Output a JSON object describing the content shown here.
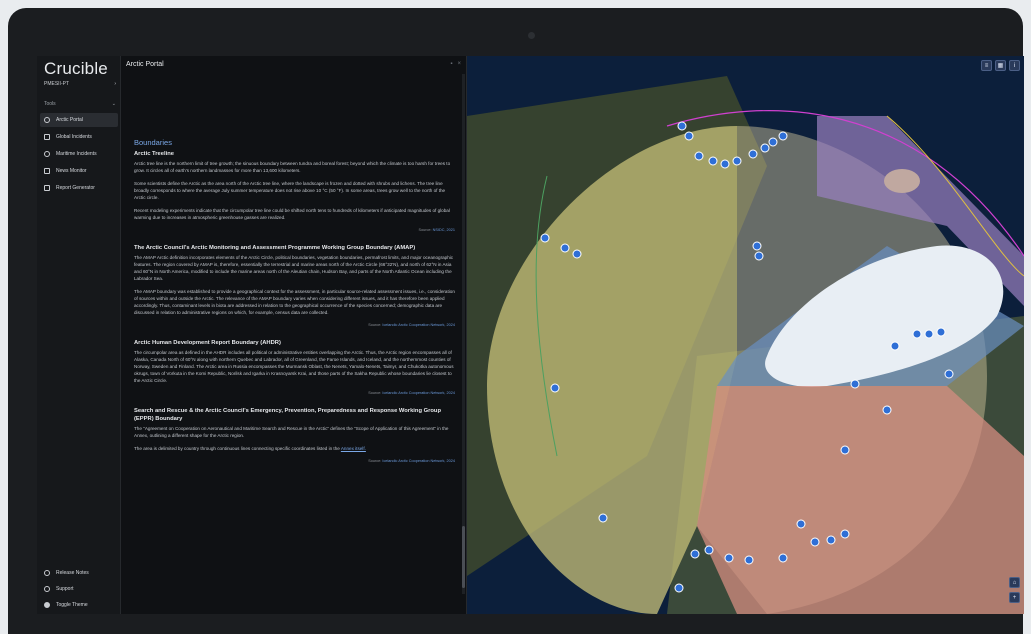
{
  "app": {
    "name": "Crucible"
  },
  "sidebar": {
    "project": "PMESII-PT",
    "section": "Tools",
    "items": [
      {
        "label": "Arctic Portal",
        "icon": "globe-icon",
        "active": true
      },
      {
        "label": "Global Incidents",
        "icon": "alert-icon",
        "active": false
      },
      {
        "label": "Maritime Incidents",
        "icon": "anchor-icon",
        "active": false
      },
      {
        "label": "News Monitor",
        "icon": "news-icon",
        "active": false
      },
      {
        "label": "Report Generator",
        "icon": "document-icon",
        "active": false
      }
    ],
    "footer": [
      {
        "label": "Release Notes",
        "icon": "info-icon"
      },
      {
        "label": "Support",
        "icon": "support-icon"
      },
      {
        "label": "Toggle Theme",
        "icon": "theme-icon"
      }
    ]
  },
  "panel": {
    "title": "Arctic Portal",
    "heading": "Boundaries",
    "sections": [
      {
        "title": "Arctic Treeline",
        "paragraphs": [
          "Arctic tree line is the northern limit of tree growth; the sinuous boundary between tundra and boreal forest; beyond which the climate is too harsh for trees to grow. It circles all of earth's northern landmasses for more than 13,600 kilometers.",
          "Some scientists define the Arctic as the area north of the Arctic tree line, where the landscape is frozen and dotted with shrubs and lichens. The tree line broadly corresponds to where the average July summer temperature does not rise above 10 °C (50 °F). In some areas, trees grow well to the north of the Arctic circle.",
          "Recent modeling experiments indicate that the circumpolar tree line could be shifted north tens to hundreds of kilometers if anticipated magnitudes of global warming due to increases in atmospheric greenhouse gasses are realized."
        ],
        "source_prefix": "Source:",
        "source": "NSIDC, 2021"
      },
      {
        "title": "The Arctic Council's Arctic Monitoring and Assessment Programme Working Group Boundary (AMAP)",
        "paragraphs": [
          "The AMAP Arctic definition incorporates elements of the Arctic Circle, political boundaries, vegetation boundaries, permafrost limits, and major oceanographic features. The region covered by AMAP is, therefore, essentially the terrestrial and marine areas north of the Arctic Circle (66°32'N), and north of 62°N in Asia and 60°N in North America, modified to include the marine areas north of the Aleutian chain, Hudson Bay, and parts of the North Atlantic Ocean including the Labrador Sea.",
          "The AMAP boundary was established to provide a geographical context for the assessment, in particular source-related assessment issues, i.e., consideration of sources within and outside the Arctic. The relevance of the AMAP boundary varies when considering different issues, and it has therefore been applied accordingly. Thus, contaminant levels in biota are addressed in relation to the geographical occurrence of the species concerned; demographic data are discussed in relation to administrative regions on which, for example, census data are collected."
        ],
        "source_prefix": "Source:",
        "source": "Icelandic Arctic Cooperation Network, 2024"
      },
      {
        "title": "Arctic Human Development Report Boundary (AHDR)",
        "paragraphs": [
          "The circumpolar area as defined in the AHDR includes all political or administrative entities overlapping the Arctic. Thus, the Arctic region encompasses all of Alaska, Canada North of 60°N along with northern Quebec and Labrador, all of Greenland, the Faroe Islands, and Iceland, and the northernmost counties of Norway, Sweden and Finland. The Arctic area in Russia encompasses the Murmansk Oblast, the Nenets, Yamalo-Nenets, Taimyr, and Chukotka autonomous okrugs, town of Vorkuta in the Komi Republic, Norilsk and Igarka in Krasnoyarsk Krai, and those parts of the Sakha Republic whose boundaries lie closest to the Arctic Circle."
        ],
        "source_prefix": "Source:",
        "source": "Icelandic Arctic Cooperation Network, 2024"
      },
      {
        "title": "Search and Rescue & the Arctic Council's Emergency, Prevention, Preparedness and Response Working Group (EPPR) Boundary",
        "paragraphs": [
          "The \"Agreement on Cooperation on Aeronautical and Maritime Search and Rescue in the Arctic\" defines the \"Scope of Application of this Agreement\" in the Annex, outlining a different shape for the Arctic region."
        ],
        "tail_text": "The area is delimited by country through continuous lines connecting specific coordinates listed in the",
        "tail_link": "Annex itself.",
        "source_prefix": "Source:",
        "source": "Icelandic Arctic Cooperation Network, 2024"
      }
    ]
  },
  "map": {
    "controls": [
      "layers-icon",
      "basemap-icon",
      "info-icon"
    ],
    "zoom": [
      "home-icon",
      "zoom-in-icon"
    ],
    "colors": {
      "ocean": "#0c1f3b",
      "treeline": "#c8c27a",
      "amap": "#d48c80",
      "ahdr": "#9a80c0",
      "eppr": "#6a8fc0",
      "marker": "#2f6fd6"
    }
  }
}
